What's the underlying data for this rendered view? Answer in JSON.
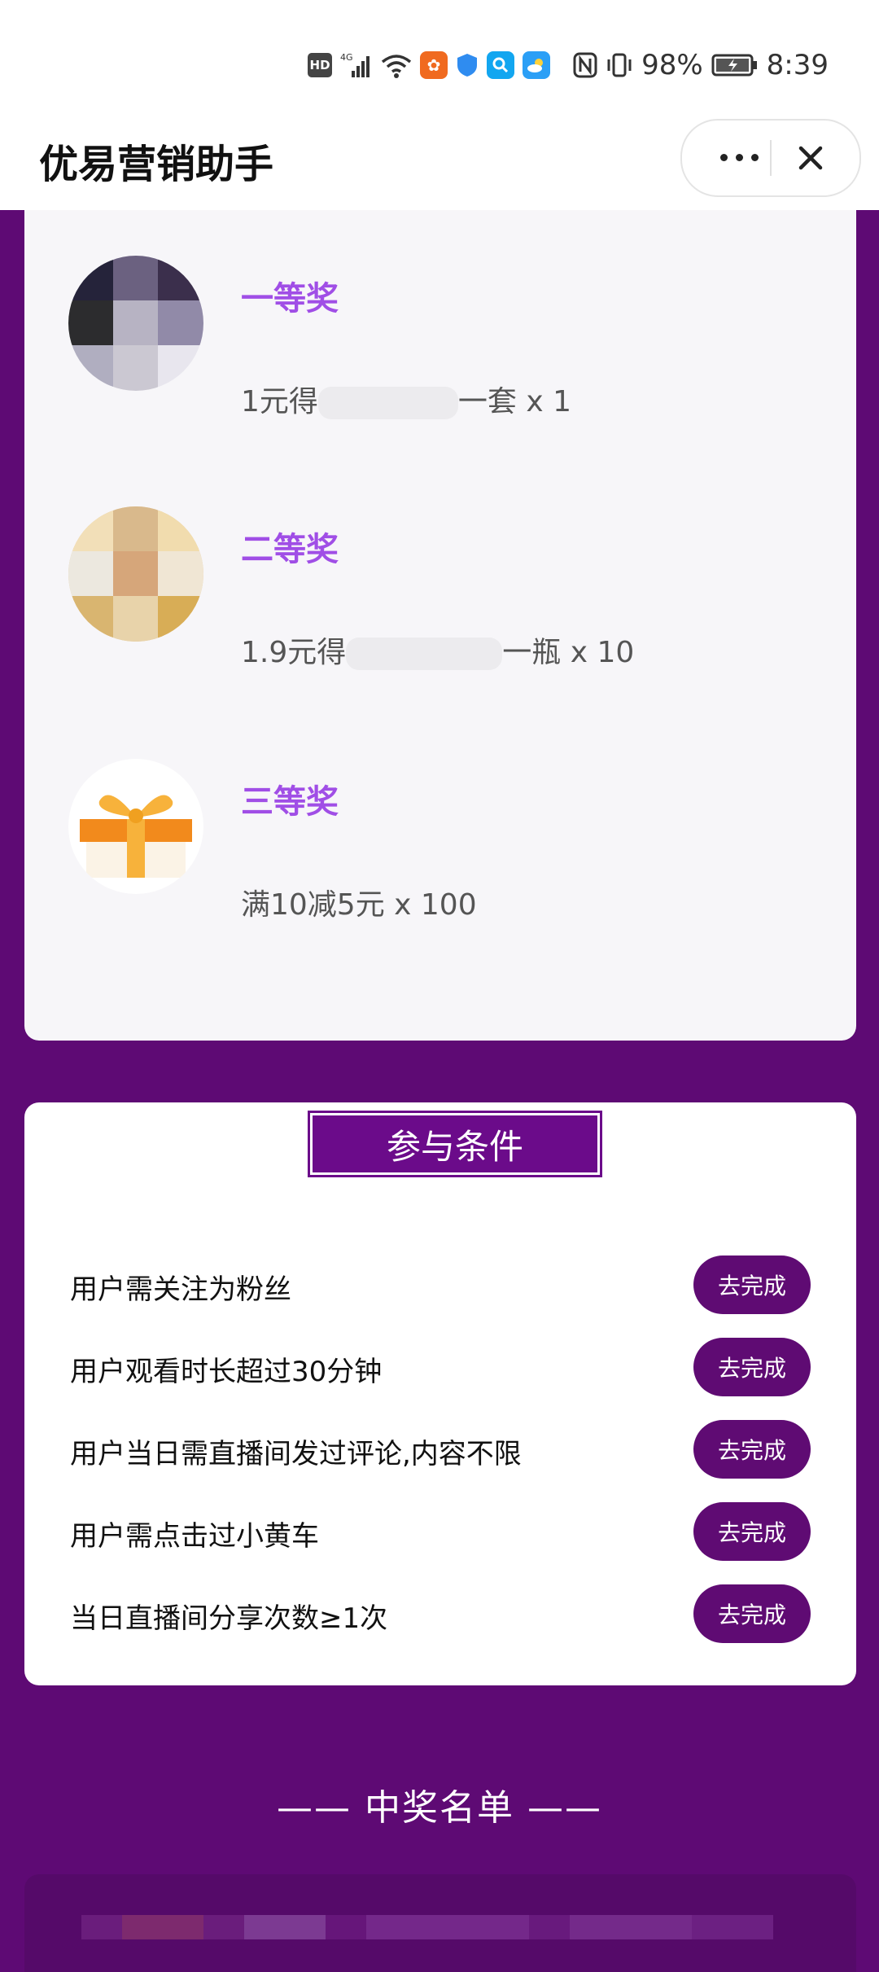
{
  "status_bar": {
    "battery": "98%",
    "time": "8:39",
    "hd_label": "HD",
    "network_label": "4G"
  },
  "nav": {
    "title": "优易营销助手"
  },
  "prizes": [
    {
      "level": "一等奖",
      "desc_prefix": "1元得",
      "desc_suffix": "一套 x 1"
    },
    {
      "level": "二等奖",
      "desc_prefix": "1.9元得",
      "desc_suffix": "一瓶 x 10"
    },
    {
      "level": "三等奖",
      "desc_prefix": "满10减5元 x 100",
      "desc_suffix": ""
    }
  ],
  "conditions": {
    "title": "参与条件",
    "button_label": "去完成",
    "items": [
      "用户需关注为粉丝",
      "用户观看时长超过30分钟",
      "用户当日需直播间发过评论,内容不限",
      "用户需点击过小黄车",
      "当日直播间分享次数≥1次"
    ]
  },
  "winners": {
    "heading": "—— 中奖名单 ——"
  },
  "colors": {
    "page_background": "#5e0a74",
    "button": "#5f0b73",
    "prize_level": "#a04ee6"
  }
}
